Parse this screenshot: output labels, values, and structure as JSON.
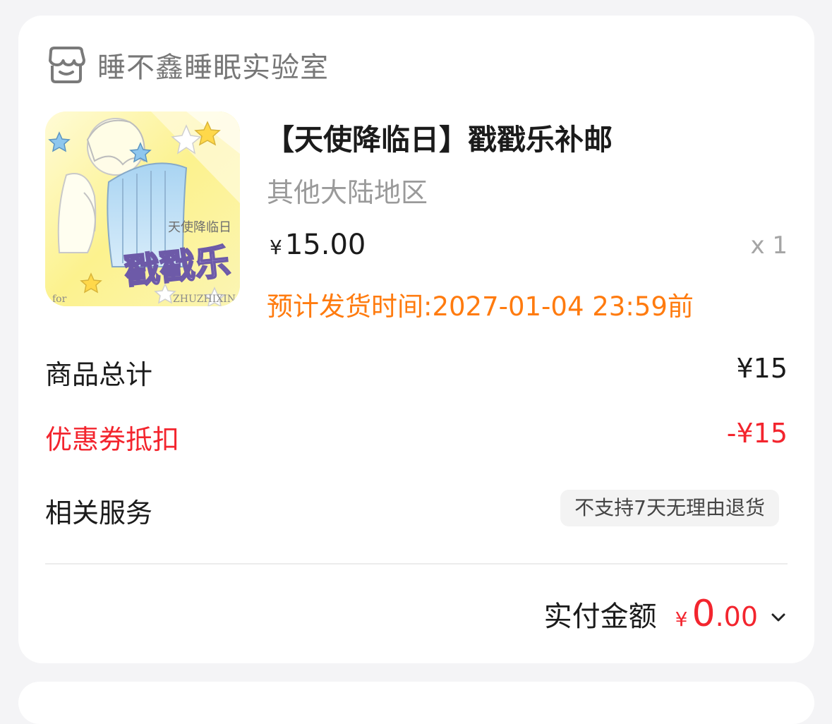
{
  "shop": {
    "name": "睡不鑫睡眠实验室",
    "icon": "store-icon"
  },
  "product": {
    "title": "【天使降临日】戳戳乐补邮",
    "variant": "其他大陆地区",
    "price_currency": "¥",
    "price_value": "15.00",
    "quantity": "x 1",
    "ship_time": "预计发货时间:2027-01-04 23:59前",
    "thumbnail": {
      "title_art": "戳戳乐",
      "subtitle_art": "天使降临日",
      "footer_left": "for",
      "footer_right": "ZHUZHIXIN"
    }
  },
  "summary": {
    "goods_total_label": "商品总计",
    "goods_total_value": "¥15",
    "coupon_label": "优惠券抵扣",
    "coupon_value": "-¥15",
    "service_label": "相关服务",
    "service_tag": "不支持7天无理由退货"
  },
  "payment": {
    "label": "实付金额",
    "currency": "¥",
    "int_part": "0",
    "dec_part": ".00",
    "expand_icon": "chevron-down-icon"
  },
  "colors": {
    "accent_red": "#f3252e",
    "ship_orange": "#ff7b0f",
    "muted_gray": "#9a9a9a"
  }
}
